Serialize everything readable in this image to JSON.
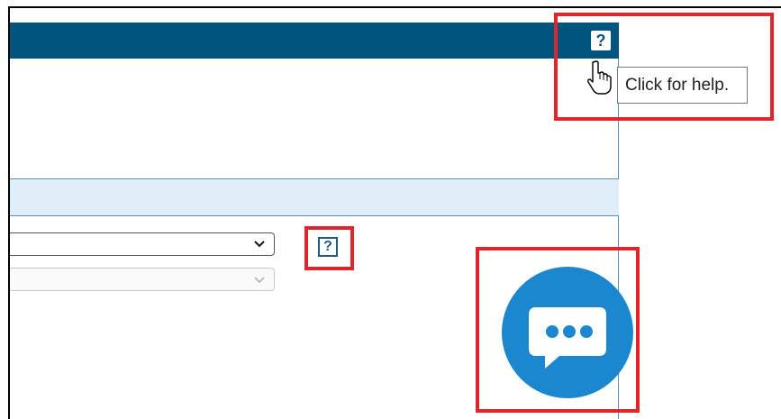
{
  "header": {
    "help_icon_label": "?"
  },
  "tooltip": {
    "text": "Click for help."
  },
  "field_help": {
    "label": "?"
  },
  "selects": [
    {
      "chevron": "∨"
    },
    {
      "chevron": "∨"
    }
  ],
  "icons": {
    "header_help": "help-icon",
    "cursor": "hand-pointer-icon",
    "field_help": "help-icon",
    "chat": "chat-bubble-icon"
  },
  "colors": {
    "header": "#00557f",
    "highlight": "#e0262b",
    "chat": "#1a87cf",
    "section_band": "#dfeef8"
  }
}
